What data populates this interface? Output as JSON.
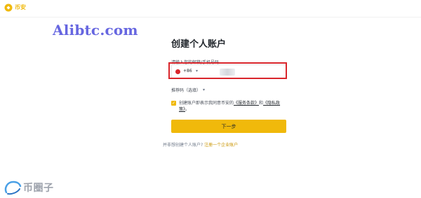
{
  "brand": {
    "name": "币安",
    "logo_icon": "binance-logo-icon",
    "accent": "#f0b90b"
  },
  "watermark": "Alibtc.com",
  "form": {
    "title": "创建个人账户",
    "phone_label": "请输入您的邮箱/手机号码",
    "country_code": "+86",
    "country_flag_icon": "china-flag-icon",
    "phone_value": "",
    "referral_label": "推荐码（选填）",
    "agree_prefix": "创建账户即表示我同意币安的",
    "terms_link": "《服务条款》",
    "agree_and": "和",
    "privacy_link": "《隐私政策》",
    "agree_suffix": "。",
    "next_button": "下一步",
    "enterprise_prompt": "并非想创建个人账户?",
    "enterprise_link": "注册一个企业账户"
  },
  "corner_watermark": {
    "text": "币圈子",
    "icon": "biquanzi-logo-icon"
  },
  "colors": {
    "highlight_box": "#d9262c",
    "button": "#f0b90b",
    "link": "#c99400"
  }
}
